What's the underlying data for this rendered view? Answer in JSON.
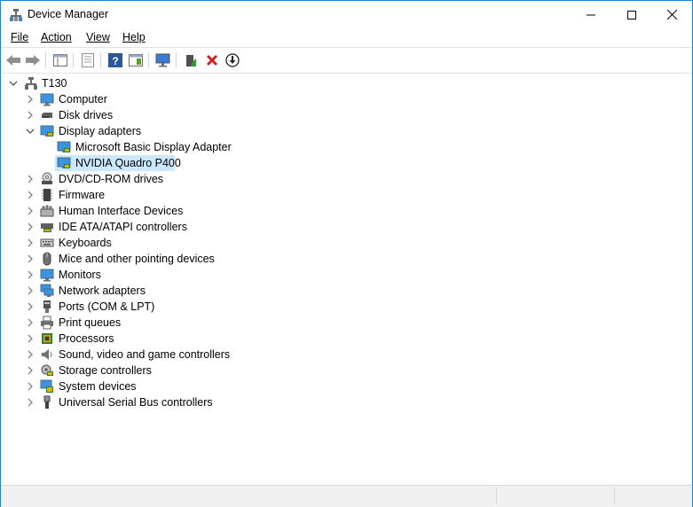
{
  "window": {
    "title": "Device Manager"
  },
  "menu": {
    "file": "File",
    "action": "Action",
    "view": "View",
    "help": "Help"
  },
  "toolbar": {
    "icons": [
      "back-arrow-icon",
      "forward-arrow-icon",
      "show-hide-console-tree-icon",
      "properties-icon",
      "help-icon",
      "action-pane-icon",
      "scan-hardware-icon",
      "update-driver-icon",
      "uninstall-device-icon",
      "disable-device-icon"
    ]
  },
  "tree": {
    "root": "T130",
    "items": [
      {
        "label": "Computer",
        "icon": "computer-icon",
        "expanded": false
      },
      {
        "label": "Disk drives",
        "icon": "disk-drive-icon",
        "expanded": false
      },
      {
        "label": "Display adapters",
        "icon": "display-adapter-icon",
        "expanded": true
      },
      {
        "label": "Microsoft Basic Display Adapter",
        "icon": "display-adapter-icon",
        "child": true
      },
      {
        "label": "NVIDIA Quadro P400",
        "icon": "display-adapter-icon",
        "child": true,
        "selected": true
      },
      {
        "label": "DVD/CD-ROM drives",
        "icon": "dvd-drive-icon",
        "expanded": false
      },
      {
        "label": "Firmware",
        "icon": "firmware-icon",
        "expanded": false
      },
      {
        "label": "Human Interface Devices",
        "icon": "hid-icon",
        "expanded": false
      },
      {
        "label": "IDE ATA/ATAPI controllers",
        "icon": "ide-controller-icon",
        "expanded": false
      },
      {
        "label": "Keyboards",
        "icon": "keyboard-icon",
        "expanded": false
      },
      {
        "label": "Mice and other pointing devices",
        "icon": "mouse-icon",
        "expanded": false
      },
      {
        "label": "Monitors",
        "icon": "monitor-icon",
        "expanded": false
      },
      {
        "label": "Network adapters",
        "icon": "network-adapter-icon",
        "expanded": false
      },
      {
        "label": "Ports (COM & LPT)",
        "icon": "port-icon",
        "expanded": false
      },
      {
        "label": "Print queues",
        "icon": "printer-icon",
        "expanded": false
      },
      {
        "label": "Processors",
        "icon": "processor-icon",
        "expanded": false
      },
      {
        "label": "Sound, video and game controllers",
        "icon": "speaker-icon",
        "expanded": false
      },
      {
        "label": "Storage controllers",
        "icon": "storage-controller-icon",
        "expanded": false
      },
      {
        "label": "System devices",
        "icon": "system-devices-icon",
        "expanded": false
      },
      {
        "label": "Universal Serial Bus controllers",
        "icon": "usb-icon",
        "expanded": false
      }
    ]
  },
  "colors": {
    "selection": "#cce8ff",
    "border": "#1883d7"
  }
}
